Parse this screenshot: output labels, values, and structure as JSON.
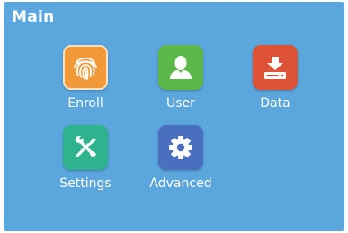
{
  "screen": {
    "title": "Main",
    "background_color": "#5ba6dc"
  },
  "menu": [
    {
      "label": "Enroll",
      "icon": "fingerprint-icon",
      "color": "#f29a3a"
    },
    {
      "label": "User",
      "icon": "user-icon",
      "color": "#5cb848"
    },
    {
      "label": "Data",
      "icon": "data-import-icon",
      "color": "#de5238"
    },
    {
      "label": "Settings",
      "icon": "tools-icon",
      "color": "#2eb38e"
    },
    {
      "label": "Advanced",
      "icon": "gear-icon",
      "color": "#4a6fbf"
    }
  ]
}
